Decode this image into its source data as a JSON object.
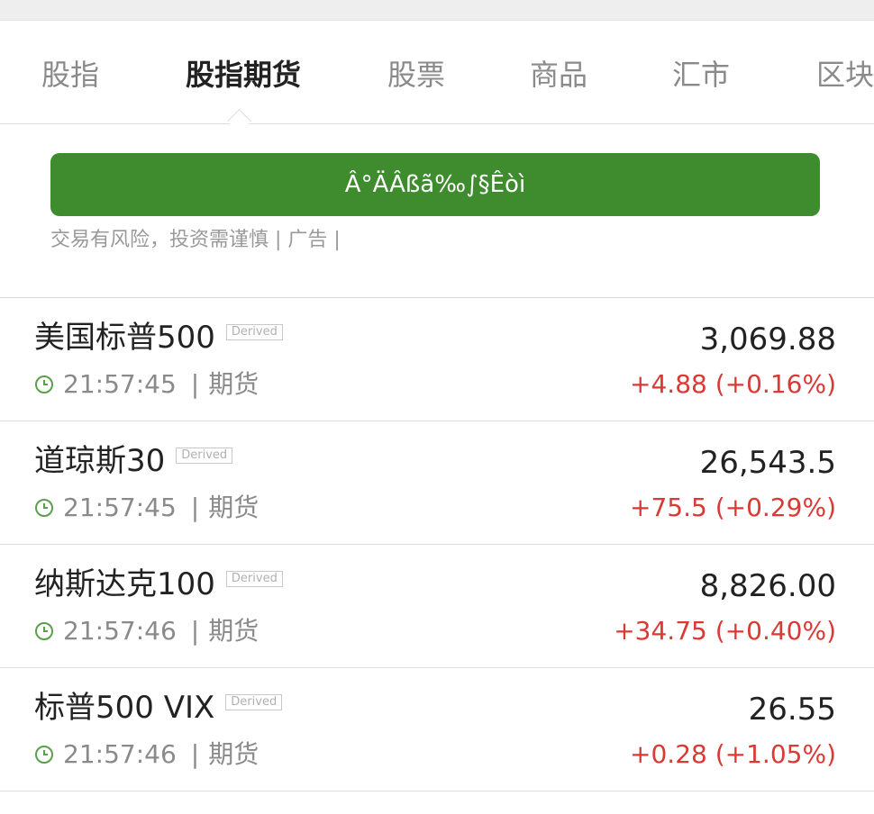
{
  "tabs": [
    {
      "label": "股指",
      "active": false
    },
    {
      "label": "股指期货",
      "active": true
    },
    {
      "label": "股票",
      "active": false
    },
    {
      "label": "商品",
      "active": false
    },
    {
      "label": "汇市",
      "active": false
    },
    {
      "label": "区块",
      "active": false
    }
  ],
  "ad": {
    "button_label": "Â°ÄÂßã‰∫§Êòì",
    "disclaimer": "交易有风险，投资需谨慎 | 广告 |"
  },
  "quotes": [
    {
      "name": "美国标普500",
      "badge": "Derived",
      "time": "21:57:45",
      "type": "期货",
      "price": "3,069.88",
      "change": "+4.88 (+0.16%)"
    },
    {
      "name": "道琼斯30",
      "badge": "Derived",
      "time": "21:57:45",
      "type": "期货",
      "price": "26,543.5",
      "change": "+75.5 (+0.29%)"
    },
    {
      "name": "纳斯达克100",
      "badge": "Derived",
      "time": "21:57:46",
      "type": "期货",
      "price": "8,826.00",
      "change": "+34.75 (+0.40%)"
    },
    {
      "name": "标普500 VIX",
      "badge": "Derived",
      "time": "21:57:46",
      "type": "期货",
      "price": "26.55",
      "change": "+0.28 (+1.05%)"
    }
  ],
  "colors": {
    "accent_green": "#3f8c2f",
    "positive_red": "#d93a35",
    "clock_green": "#5aa04a"
  }
}
